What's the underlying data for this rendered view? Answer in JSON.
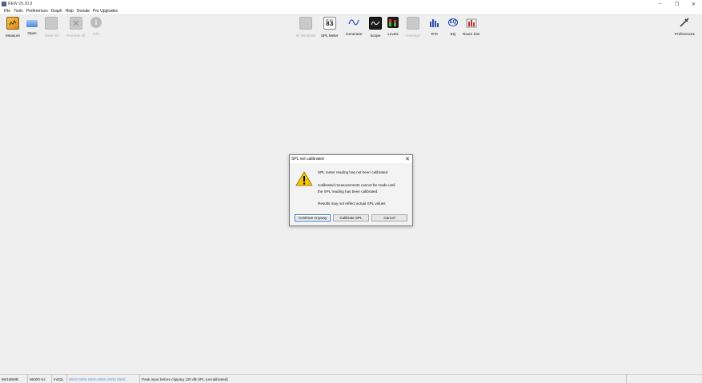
{
  "window": {
    "title": "REW V5.20.9",
    "controls": [
      "minimize-icon",
      "restore-icon",
      "close-icon"
    ]
  },
  "menu": [
    "File",
    "Tools",
    "Preferences",
    "Graph",
    "Help",
    "Donate",
    "Pro Upgrades"
  ],
  "toolbar": {
    "measure": "Measure",
    "open": "Open",
    "save_all": "Save All",
    "remove_all": "Remove All",
    "info": "Info",
    "ir_windows": "IR Windows",
    "spl_meter": "SPL Meter",
    "spl_meter_icon_label": "dB SPL",
    "spl_meter_icon_value": "83",
    "generator": "Generator",
    "scope": "Scope",
    "levels": "Levels",
    "overlays": "Overlays",
    "rta": "RTA",
    "eq": "EQ",
    "eq_icon_text": "EQ",
    "room_sim": "Room Sim",
    "preferences": "Preferences"
  },
  "dialog": {
    "title": "SPL not calibrated",
    "line1": "SPL meter reading has not been calibrated",
    "line2": "Calibrated measurements cannot be made until",
    "line3": "the SPL reading has been calibrated.",
    "line4": "Results may not reflect actual SPL values",
    "btn_continue": "Continue Anyway",
    "btn_calibrate": "Calibrate SPL",
    "btn_cancel": "Cancel"
  },
  "status": {
    "memory": "86/186MB",
    "sample_rate": "96000 Hz",
    "format": "Int32L",
    "meters": "0000 0000  0000 0000  0000 0000",
    "message": "Peak input before clipping 120 dB SPL (uncalibrated)"
  },
  "colors": {
    "accent": "#3a78c8",
    "warning": "#f5c400"
  }
}
